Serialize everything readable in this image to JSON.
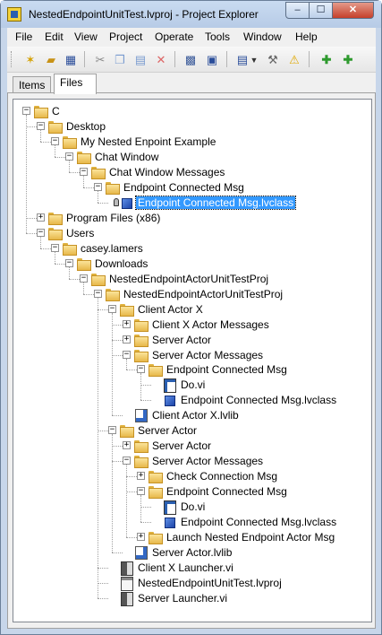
{
  "window": {
    "title": "NestedEndpointUnitTest.lvproj - Project Explorer",
    "minimize": "‒",
    "maximize": "☐",
    "close": "✕"
  },
  "menu": [
    "File",
    "Edit",
    "View",
    "Project",
    "Operate",
    "Tools",
    "Window",
    "Help"
  ],
  "toolbar": {
    "icons": [
      "new-icon",
      "open-icon",
      "save-all-icon",
      "cut-icon",
      "copy-icon",
      "paste-icon",
      "delete-icon",
      "build-icon",
      "deploy-icon",
      "view-options-icon",
      "dropdown-arrow-icon",
      "wrench-icon",
      "warning-icon",
      "add-item-icon",
      "add-folder-icon"
    ]
  },
  "tabs": [
    {
      "label": "Items",
      "active": false
    },
    {
      "label": "Files",
      "active": true
    }
  ],
  "tree": [
    {
      "label": "C",
      "type": "folder",
      "depth": 0,
      "expanded": true
    },
    {
      "label": "Desktop",
      "type": "folder",
      "depth": 1,
      "expanded": true
    },
    {
      "label": "My Nested Enpoint Example",
      "type": "folder",
      "depth": 2,
      "expanded": true
    },
    {
      "label": "Chat Window",
      "type": "folder",
      "depth": 3,
      "expanded": true
    },
    {
      "label": "Chat Window Messages",
      "type": "folder",
      "depth": 4,
      "expanded": true
    },
    {
      "label": "Endpoint Connected Msg",
      "type": "folder",
      "depth": 5,
      "expanded": true
    },
    {
      "label": "Endpoint Connected Msg.lvclass",
      "type": "class",
      "depth": 6,
      "selected": true,
      "locked": true
    },
    {
      "label": "Program Files (x86)",
      "type": "folder",
      "depth": 1,
      "expanded": false
    },
    {
      "label": "Users",
      "type": "folder",
      "depth": 1,
      "expanded": true
    },
    {
      "label": "casey.lamers",
      "type": "folder",
      "depth": 2,
      "expanded": true
    },
    {
      "label": "Downloads",
      "type": "folder",
      "depth": 3,
      "expanded": true
    },
    {
      "label": "NestedEndpointActorUnitTestProj",
      "type": "folder",
      "depth": 4,
      "expanded": true
    },
    {
      "label": "NestedEndpointActorUnitTestProj",
      "type": "folder",
      "depth": 5,
      "expanded": true
    },
    {
      "label": "Client Actor X",
      "type": "folder",
      "depth": 6,
      "expanded": true
    },
    {
      "label": "Client X Actor Messages",
      "type": "folder",
      "depth": 7,
      "expanded": false
    },
    {
      "label": "Server Actor",
      "type": "folder",
      "depth": 7,
      "expanded": false
    },
    {
      "label": "Server Actor Messages",
      "type": "folder",
      "depth": 7,
      "expanded": true
    },
    {
      "label": "Endpoint Connected Msg",
      "type": "folder",
      "depth": 8,
      "expanded": true
    },
    {
      "label": "Do.vi",
      "type": "vi",
      "depth": 9
    },
    {
      "label": "Endpoint Connected Msg.lvclass",
      "type": "class",
      "depth": 9
    },
    {
      "label": "Client Actor X.lvlib",
      "type": "lib",
      "depth": 7
    },
    {
      "label": "Server Actor",
      "type": "folder",
      "depth": 6,
      "expanded": true
    },
    {
      "label": "Server Actor",
      "type": "folder",
      "depth": 7,
      "expanded": false
    },
    {
      "label": "Server Actor Messages",
      "type": "folder",
      "depth": 7,
      "expanded": true
    },
    {
      "label": "Check Connection Msg",
      "type": "folder",
      "depth": 8,
      "expanded": false
    },
    {
      "label": "Endpoint Connected Msg",
      "type": "folder",
      "depth": 8,
      "expanded": true
    },
    {
      "label": "Do.vi",
      "type": "vi",
      "depth": 9
    },
    {
      "label": "Endpoint Connected Msg.lvclass",
      "type": "class",
      "depth": 9
    },
    {
      "label": "Launch Nested Endpoint Actor Msg",
      "type": "folder",
      "depth": 8,
      "expanded": false
    },
    {
      "label": "Server Actor.lvlib",
      "type": "lib",
      "depth": 7
    },
    {
      "label": "Client X Launcher.vi",
      "type": "launch",
      "depth": 6
    },
    {
      "label": "NestedEndpointUnitTest.lvproj",
      "type": "proj",
      "depth": 6
    },
    {
      "label": "Server Launcher.vi",
      "type": "launch",
      "depth": 6
    }
  ]
}
